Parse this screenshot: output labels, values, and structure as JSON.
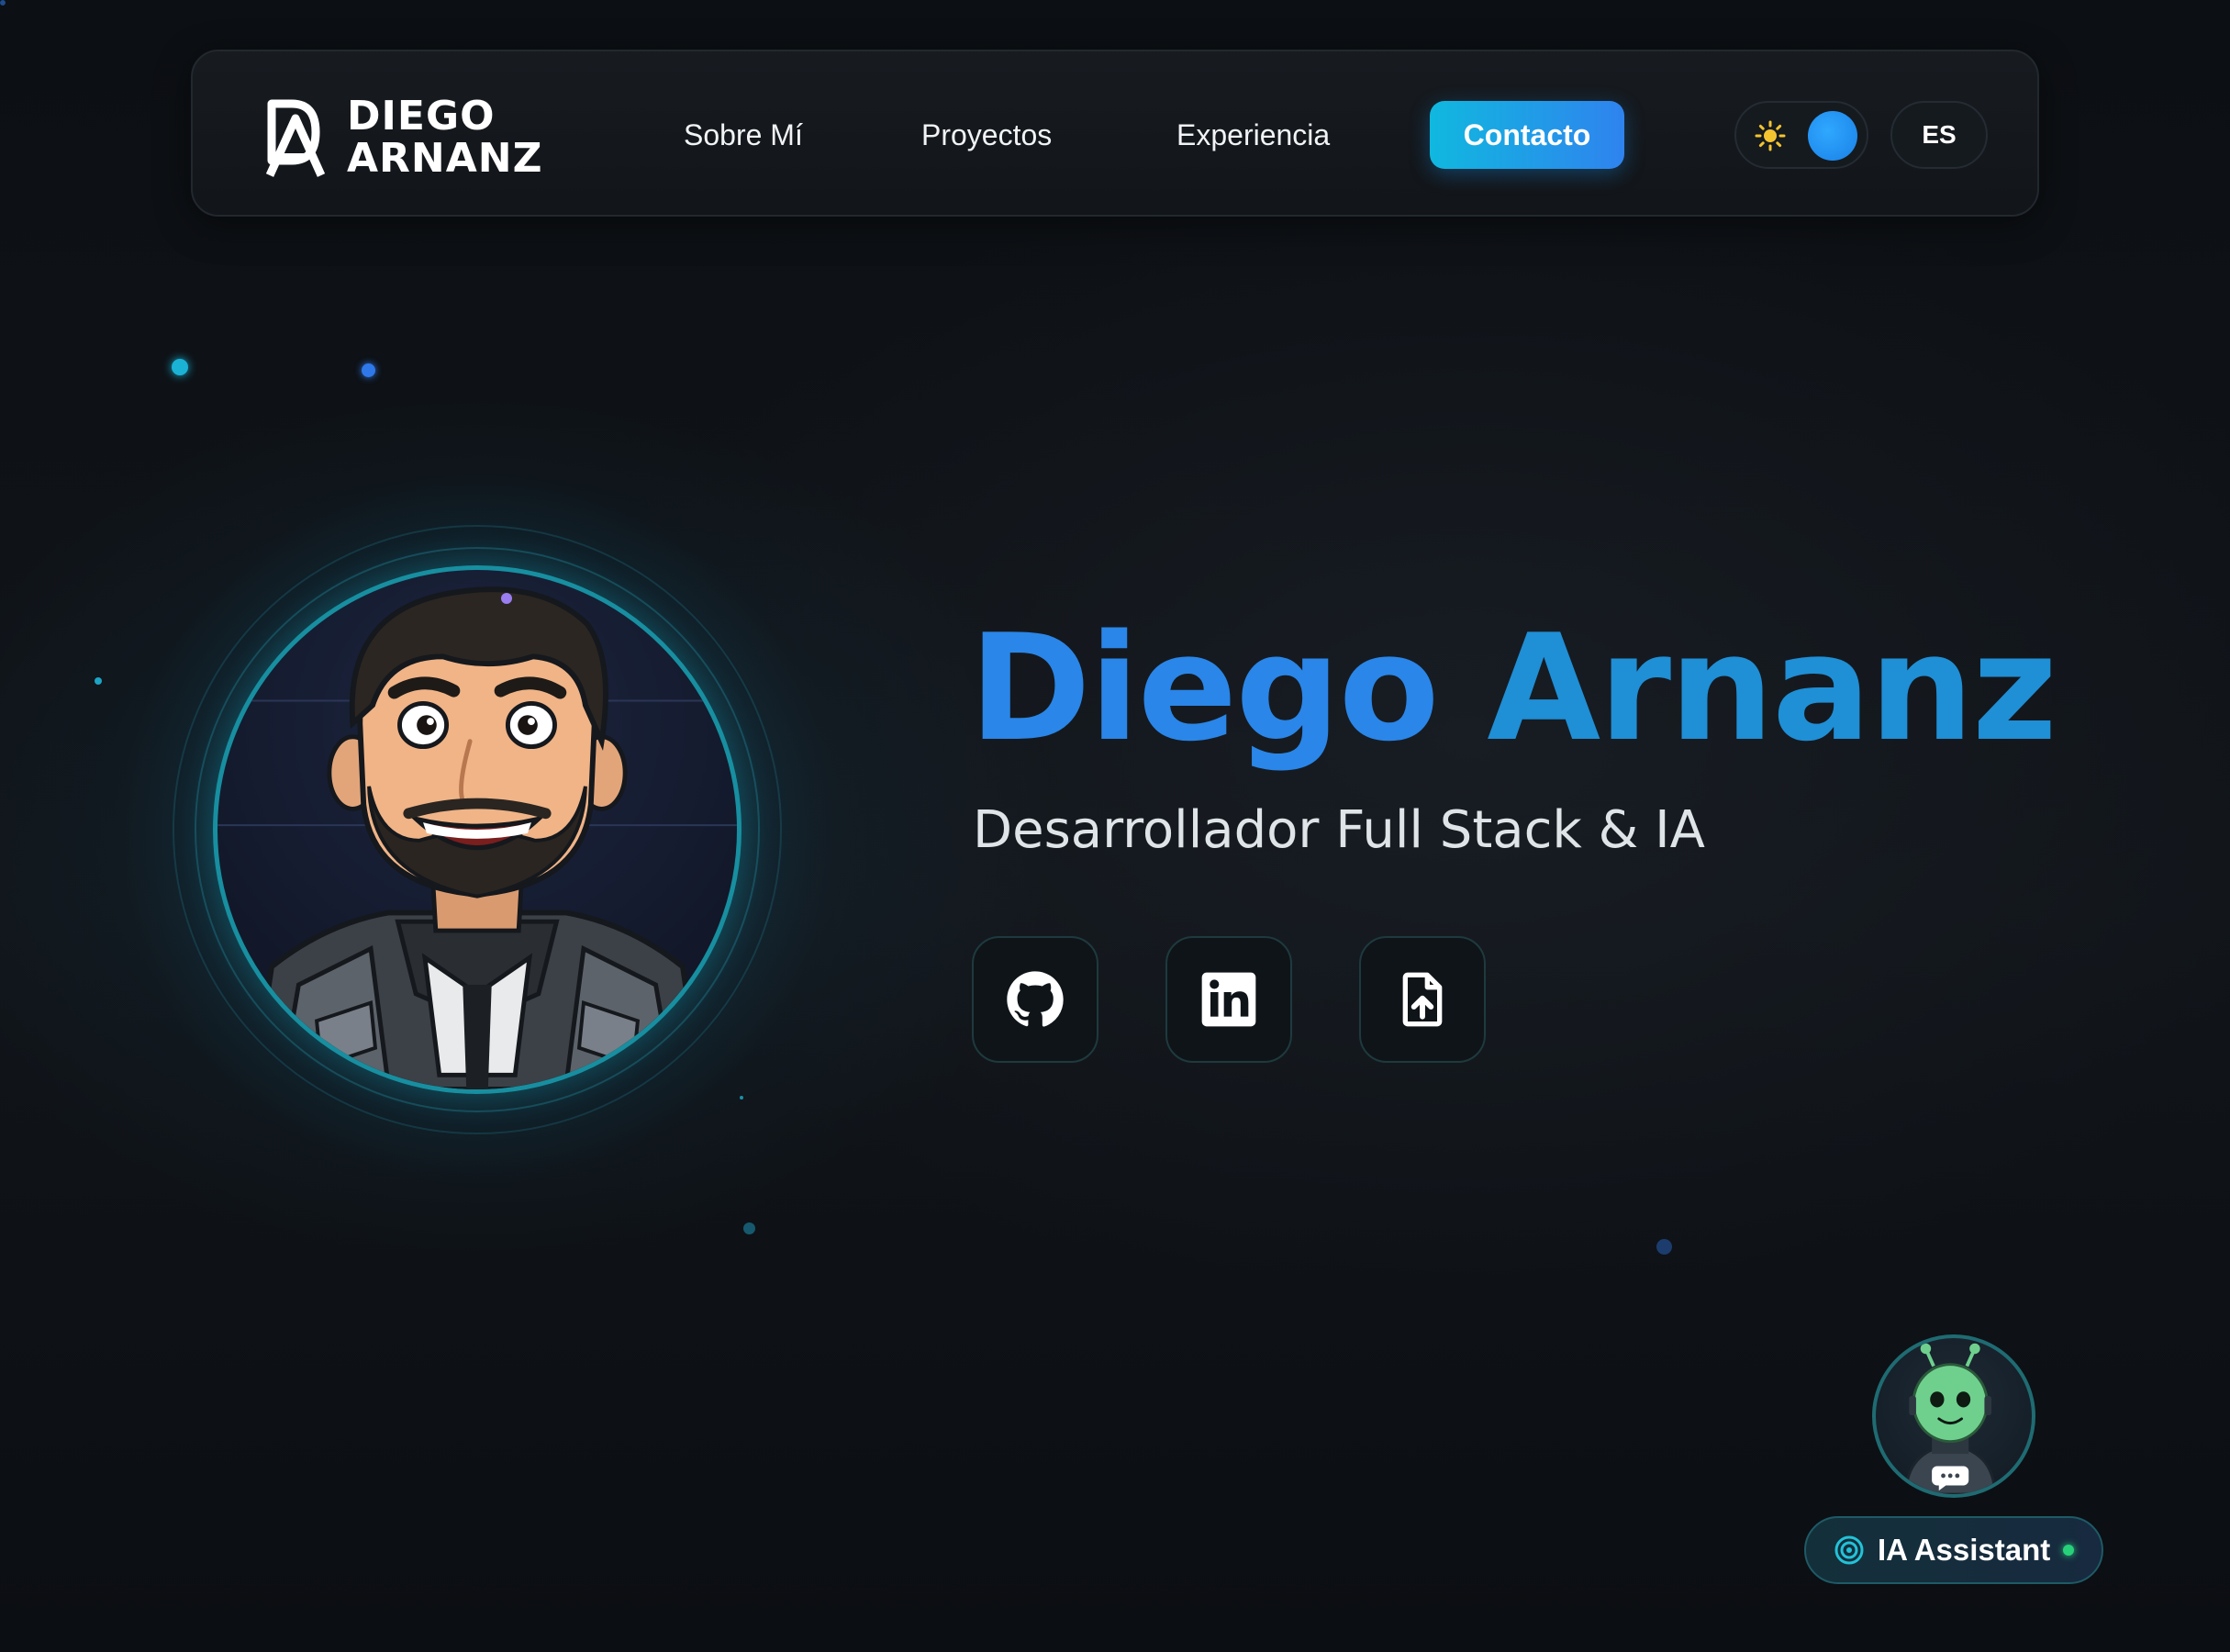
{
  "brand": {
    "monogram": "DA",
    "line1": "DIEGO",
    "line2": "ARNANZ"
  },
  "nav": {
    "items": [
      {
        "label": "Sobre Mí"
      },
      {
        "label": "Proyectos"
      },
      {
        "label": "Experiencia"
      }
    ],
    "contact_label": "Contacto",
    "theme_icon": "sun-icon",
    "language": "ES"
  },
  "hero": {
    "name_first": "Diego",
    "name_last": "Arnanz",
    "role": "Desarrollador Full Stack & IA",
    "socials": [
      {
        "icon": "github-icon"
      },
      {
        "icon": "linkedin-icon"
      },
      {
        "icon": "file-upload-icon"
      }
    ]
  },
  "assistant": {
    "label": "IA Assistant",
    "status": "online"
  },
  "colors": {
    "accent_blue": "#2a86e8",
    "accent_cyan": "#10b8df",
    "background": "#0d1014",
    "status_green": "#27d17a"
  }
}
